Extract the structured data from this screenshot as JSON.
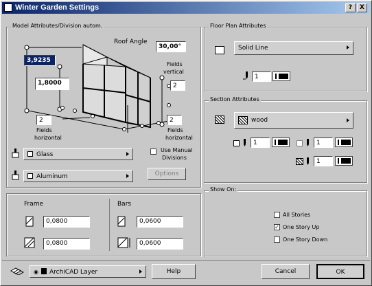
{
  "title": "Winter Garden Settings",
  "title_buttons": {
    "help": "?",
    "close": "X"
  },
  "model": {
    "group_label": "Model Attributes/Division autom.",
    "roof_angle_label": "Roof Angle",
    "roof_angle_value": "30,00°",
    "value_1": "3,9235",
    "value_2": "1,8000",
    "fields_vertical_label_1": "Fields",
    "fields_vertical_label_2": "vertical",
    "fields_vertical_value": "2",
    "fields_horizontal_left_label_1": "Fields",
    "fields_horizontal_left_label_2": "horizontal",
    "fields_horizontal_left_value": "2",
    "fields_horizontal_right_label_1": "Fields",
    "fields_horizontal_right_label_2": "horizontal",
    "fields_horizontal_right_value": "2",
    "glass_material": "Glass",
    "aluminum_material": "Aluminum",
    "use_manual_label_1": "Use Manual",
    "use_manual_label_2": "Divisions",
    "options_button": "Options"
  },
  "frame": {
    "label": "Frame",
    "value_1": "0,0800",
    "value_2": "0,0800"
  },
  "bars": {
    "label": "Bars",
    "value_1": "0,0600",
    "value_2": "0,0600"
  },
  "floor_plan": {
    "group_label": "Floor Plan Attributes",
    "line_type": "Solid Line",
    "pen_value": "1"
  },
  "section": {
    "group_label": "Section Attributes",
    "material": "wood",
    "pen_1": "1",
    "pen_2": "1",
    "pen_3": "1"
  },
  "show_on": {
    "group_label": "Show On:",
    "options": [
      {
        "label": "All Stories",
        "checked": false
      },
      {
        "label": "One Story Up",
        "checked": true
      },
      {
        "label": "One Story Down",
        "checked": false
      }
    ]
  },
  "footer": {
    "layer": "ArchiCAD Layer",
    "help": "Help",
    "cancel": "Cancel",
    "ok": "OK"
  }
}
